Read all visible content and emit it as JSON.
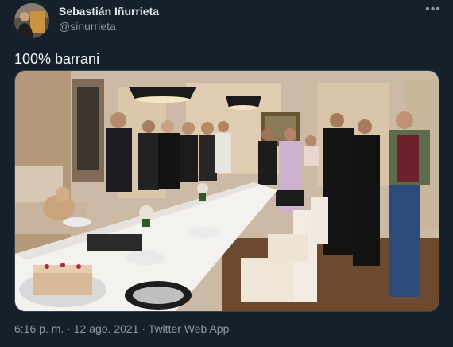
{
  "author": {
    "display_name": "Sebastián Iñurrieta",
    "handle": "@sinurrieta",
    "avatar_icon": "avatar-photo"
  },
  "menu": {
    "more_label": "•••",
    "icon": "more-icon"
  },
  "tweet": {
    "text": "100% barrani"
  },
  "media": {
    "description_icon": "dinner-photo"
  },
  "meta": {
    "time": "6:16 p. m.",
    "separator": "·",
    "date": "12 ago. 2021",
    "source": "Twitter Web App"
  },
  "colors": {
    "background": "#15202b",
    "name": "#e7e9ea",
    "secondary": "#8b98a5"
  }
}
